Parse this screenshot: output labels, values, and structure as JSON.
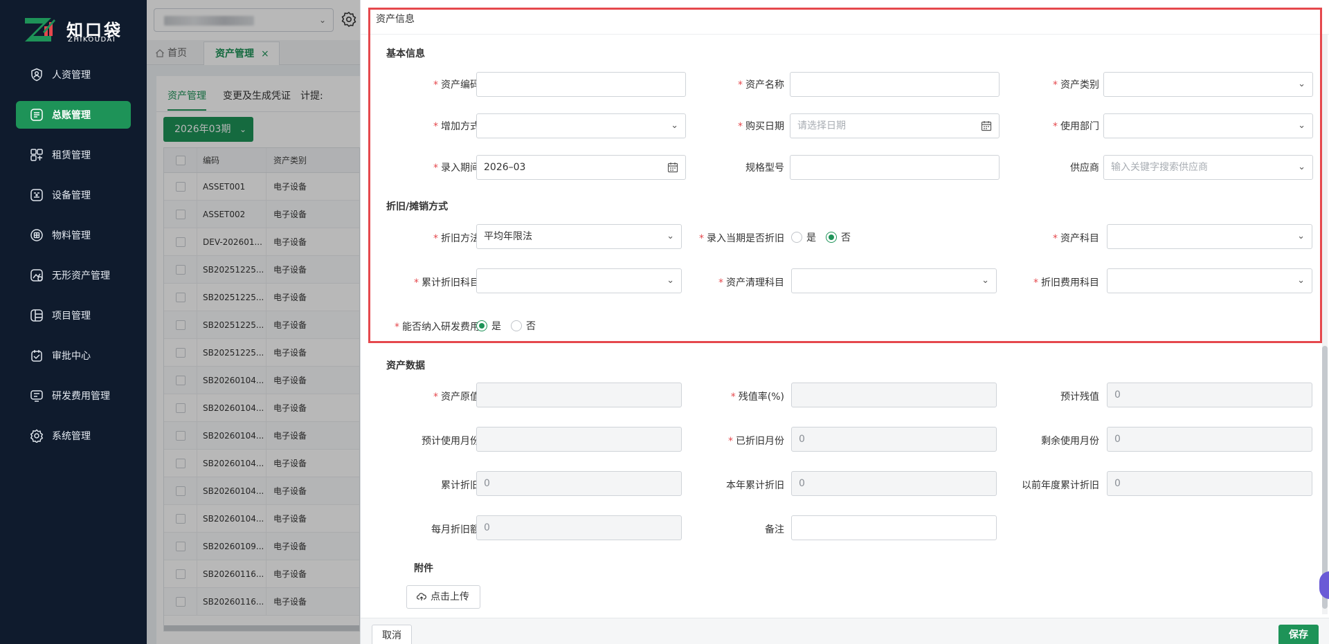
{
  "brand": {
    "name_cn": "知口袋",
    "name_en": "ZHIKOUDAI",
    "accent": "#1e9358",
    "danger": "#e5484d"
  },
  "sidebar": {
    "items": [
      {
        "label": "人资管理",
        "icon": "person-shield-icon"
      },
      {
        "label": "总账管理",
        "icon": "ledger-icon",
        "active": true
      },
      {
        "label": "租赁管理",
        "icon": "lease-icon"
      },
      {
        "label": "设备管理",
        "icon": "device-icon"
      },
      {
        "label": "物料管理",
        "icon": "material-icon"
      },
      {
        "label": "无形资产管理",
        "icon": "intangible-icon"
      },
      {
        "label": "项目管理",
        "icon": "project-icon"
      },
      {
        "label": "审批中心",
        "icon": "approval-icon"
      },
      {
        "label": "研发费用管理",
        "icon": "rd-expense-icon"
      },
      {
        "label": "系统管理",
        "icon": "gear-icon"
      }
    ]
  },
  "page_tabs": {
    "home": "首页",
    "asset": "资产管理"
  },
  "sub_tabs": [
    "资产管理",
    "变更及生成凭证",
    "计提:"
  ],
  "period": "2026年03期",
  "table": {
    "headers": [
      "编码",
      "资产类别"
    ],
    "rows": [
      [
        "ASSET001",
        "电子设备"
      ],
      [
        "ASSET002",
        "电子设备"
      ],
      [
        "DEV-202601...",
        "电子设备"
      ],
      [
        "SB20251225...",
        "电子设备"
      ],
      [
        "SB20251225...",
        "电子设备"
      ],
      [
        "SB20251225...",
        "电子设备"
      ],
      [
        "SB20251225...",
        "电子设备"
      ],
      [
        "SB20260104...",
        "电子设备"
      ],
      [
        "SB20260104...",
        "电子设备"
      ],
      [
        "SB20260104...",
        "电子设备"
      ],
      [
        "SB20260104...",
        "电子设备"
      ],
      [
        "SB20260104...",
        "电子设备"
      ],
      [
        "SB20260104...",
        "电子设备"
      ],
      [
        "SB20260109...",
        "电子设备"
      ],
      [
        "SB20260116...",
        "电子设备"
      ],
      [
        "SB20260116...",
        "电子设备"
      ]
    ]
  },
  "drawer": {
    "title": "资产信息",
    "sections": {
      "basic": "基本信息",
      "depr": "折旧/摊销方式",
      "data": "资产数据",
      "attach": "附件"
    },
    "labels": {
      "code": "资产编码",
      "name": "资产名称",
      "category": "资产类别",
      "add_method": "增加方式",
      "purchase_date": "购买日期",
      "dept": "使用部门",
      "entry_period": "录入期间",
      "spec": "规格型号",
      "supplier": "供应商",
      "depr_method": "折旧方法",
      "depr_current": "录入当期是否折旧",
      "asset_account": "资产科目",
      "acc_depr_account": "累计折旧科目",
      "clear_account": "资产清理科目",
      "depr_exp_account": "折旧费用科目",
      "rd": "能否纳入研发费用",
      "orig_value": "资产原值",
      "residual_rate": "残值率(%)",
      "est_residual": "预计残值",
      "est_months": "预计使用月份",
      "depr_months": "已折旧月份",
      "remain_months": "剩余使用月份",
      "acc_depr": "累计折旧",
      "year_acc_depr": "本年累计折旧",
      "prev_acc_depr": "以前年度累计折旧",
      "monthly_depr": "每月折旧额",
      "remark": "备注"
    },
    "values": {
      "purchase_date_ph": "请选择日期",
      "entry_period": "2026–03",
      "supplier_ph": "输入关键字搜索供应商",
      "depr_method": "平均年限法",
      "yes": "是",
      "no": "否",
      "est_residual": "0",
      "depr_months": "0",
      "remain_months": "0",
      "acc_depr": "0",
      "year_acc_depr": "0",
      "prev_acc_depr": "0",
      "monthly_depr": "0"
    },
    "upload": "点击上传",
    "cancel": "取消",
    "save": "保存"
  }
}
